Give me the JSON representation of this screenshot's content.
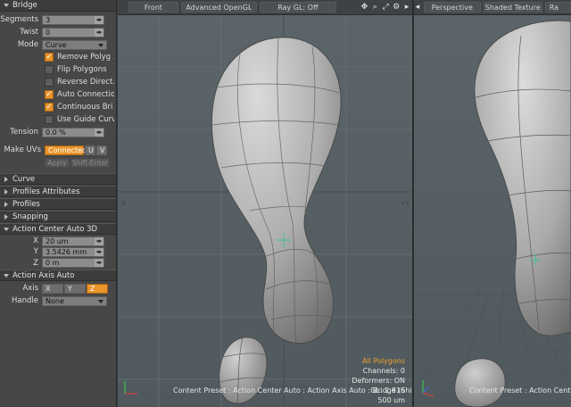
{
  "panel": {
    "bridge": {
      "header": "Bridge",
      "segments_label": "Segments",
      "segments_value": "3",
      "twist_label": "Twist",
      "twist_value": "0",
      "mode_label": "Mode",
      "mode_value": "Curve",
      "options": [
        {
          "label": "Remove Polyg ...",
          "checked": true
        },
        {
          "label": "Flip Polygons",
          "checked": false
        },
        {
          "label": "Reverse Direct...",
          "checked": false
        },
        {
          "label": "Auto Connection",
          "checked": true
        },
        {
          "label": "Continuous Bri ...",
          "checked": true
        },
        {
          "label": "Use Guide Curve",
          "checked": false
        }
      ],
      "tension_label": "Tension",
      "tension_value": "0.0 %",
      "make_uvs_label": "Make UVs",
      "uv_connected": "Connected",
      "uv_u": "U",
      "uv_v": "V",
      "apply_label": "Apply",
      "shift_enter_label": "Shift-Enter"
    },
    "sections": [
      "Curve",
      "Profiles Attributes",
      "Profiles",
      "Snapping"
    ],
    "action_center": {
      "header": "Action Center Auto 3D",
      "x_label": "X",
      "x_value": "20 um",
      "y_label": "Y",
      "y_value": "3.5426 mm",
      "z_label": "Z",
      "z_value": "0 m"
    },
    "action_axis": {
      "header": "Action Axis Auto",
      "axis_label": "Axis",
      "axis_x": "X",
      "axis_y": "Y",
      "axis_z": "Z",
      "handle_label": "Handle",
      "handle_value": "None"
    }
  },
  "viewport_front": {
    "view_label": "Front",
    "shading_label": "Advanced OpenGL",
    "ray_label": "Ray GL: Off",
    "hud": {
      "selection": "All Polygons",
      "channels": "Channels: 0",
      "deformers": "Deformers: ON",
      "gl": "GL: 2,816",
      "units": "500 um"
    },
    "status": "Content Preset : Action Center Auto : Action Axis Auto : Bridge (Shift-F)",
    "axis_x_left": "-X",
    "axis_x_right": "+X"
  },
  "viewport_persp": {
    "view_label": "Perspective",
    "shading_label": "Shaded Texture",
    "ray_label": "Ra",
    "status": "Content Preset : Action Cente"
  },
  "colors": {
    "accent": "#e9952a",
    "panel_bg": "#474747",
    "viewport_bg": "#566064",
    "model_surface": "#b4b4b4"
  }
}
